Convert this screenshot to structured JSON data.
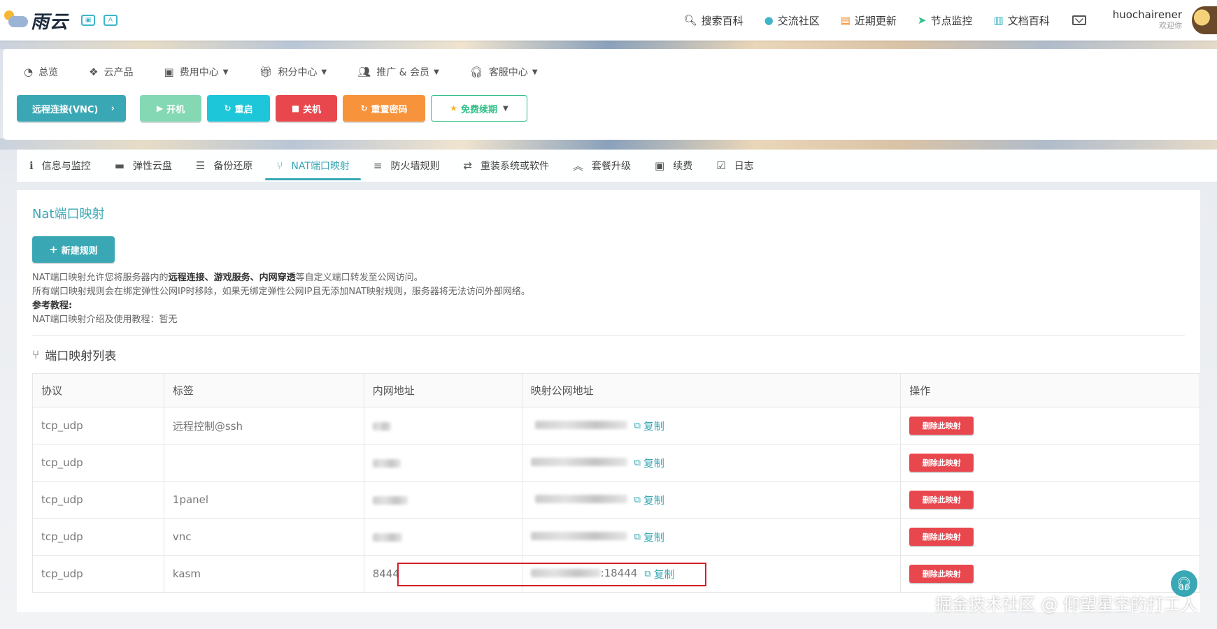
{
  "brand": {
    "name": "雨云"
  },
  "topnav": [
    {
      "icon": "search-icon",
      "label": "搜索百科"
    },
    {
      "icon": "chat-icon",
      "label": "交流社区"
    },
    {
      "icon": "update-icon",
      "label": "近期更新"
    },
    {
      "icon": "node-icon",
      "label": "节点监控"
    },
    {
      "icon": "book-icon",
      "label": "文档百科"
    }
  ],
  "user": {
    "name": "huochairener",
    "welcome": "欢迎你"
  },
  "subnav": [
    {
      "label": "总览",
      "dropdown": false
    },
    {
      "label": "云产品",
      "dropdown": false
    },
    {
      "label": "费用中心",
      "dropdown": true
    },
    {
      "label": "积分中心",
      "dropdown": true
    },
    {
      "label": "推广 & 会员",
      "dropdown": true
    },
    {
      "label": "客服中心",
      "dropdown": true
    }
  ],
  "actions": {
    "vnc": "远程连接(VNC)",
    "start": "开机",
    "restart": "重启",
    "shutdown": "关机",
    "reset_password": "重置密码",
    "free_renew": "免费续期"
  },
  "tabs": [
    {
      "label": "信息与监控",
      "active": false
    },
    {
      "label": "弹性云盘",
      "active": false
    },
    {
      "label": "备份还原",
      "active": false
    },
    {
      "label": "NAT端口映射",
      "active": true
    },
    {
      "label": "防火墙规则",
      "active": false
    },
    {
      "label": "重装系统或软件",
      "active": false
    },
    {
      "label": "套餐升级",
      "active": false
    },
    {
      "label": "续费",
      "active": false
    },
    {
      "label": "日志",
      "active": false
    }
  ],
  "card": {
    "title": "Nat端口映射",
    "new_rule": "新建规则",
    "desc": {
      "line1_prefix": "NAT端口映射允许您将服务器内的",
      "line1_bold": "远程连接、游戏服务、内网穿透",
      "line1_suffix": "等自定义端口转发至公网访问。",
      "line2": "所有端口映射规则会在绑定弹性公网IP时移除，如果无绑定弹性公网IP且无添加NAT映射规则，服务器将无法访问外部网络。",
      "line3": "参考教程:",
      "line4": "NAT端口映射介绍及使用教程：暂无"
    },
    "list_title": "端口映射列表"
  },
  "table": {
    "headers": [
      "协议",
      "标签",
      "内网地址",
      "映射公网地址",
      "操作"
    ],
    "copy_label": "复制",
    "delete_label": "删除此映射",
    "rows": [
      {
        "protocol": "tcp_udp",
        "tag": "远程控制@ssh",
        "inner": "",
        "public_suffix": ""
      },
      {
        "protocol": "tcp_udp",
        "tag": "",
        "inner": "",
        "public_suffix": ""
      },
      {
        "protocol": "tcp_udp",
        "tag": "1panel",
        "inner": "",
        "public_suffix": ""
      },
      {
        "protocol": "tcp_udp",
        "tag": "vnc",
        "inner": "",
        "public_suffix": ""
      },
      {
        "protocol": "tcp_udp",
        "tag": "kasm",
        "inner": "8444",
        "public_suffix": ":18444"
      }
    ]
  },
  "watermark": "掘金技术社区 @ 仰望星空的打工人",
  "colors": {
    "accent": "#3aa7b5",
    "danger": "#e8474e",
    "warning": "#f7933b",
    "success": "#2bbf84",
    "highlight": "#d0202a"
  }
}
